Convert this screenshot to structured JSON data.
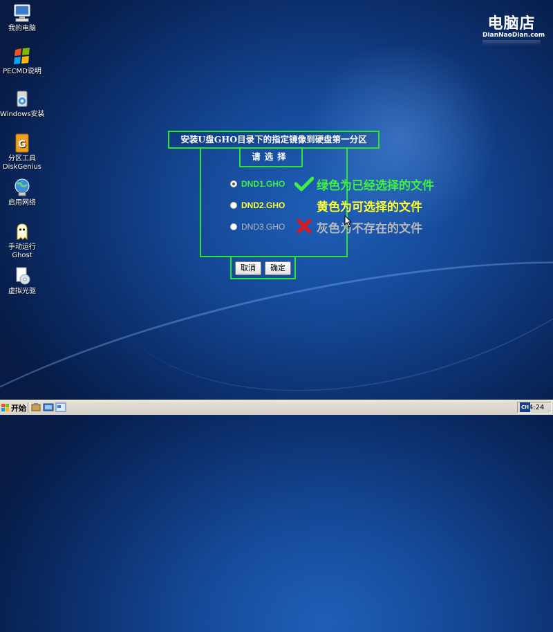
{
  "desktop": {
    "icons": [
      {
        "label": "我的电脑",
        "icon": "my-computer-icon"
      },
      {
        "label": "PECMD说明",
        "icon": "pecmd-help-icon"
      },
      {
        "label": "Windows安装",
        "icon": "windows-install-icon"
      },
      {
        "label1": "分区工具",
        "label2": "DiskGenius",
        "icon": "diskgenius-icon"
      },
      {
        "label": "启用网络",
        "icon": "network-icon"
      },
      {
        "label1": "手动运行",
        "label2": "Ghost",
        "icon": "ghost-icon"
      },
      {
        "label": "虚拟光驱",
        "icon": "virtual-cdrom-icon"
      }
    ]
  },
  "logo": {
    "text": "电脑店",
    "sub": "DianNaoDian.com"
  },
  "dialog": {
    "title": "安装U盘GHO目录下的指定镜像到硬盘第一分区",
    "select_label": "请选择",
    "options": [
      {
        "label": "DND1.GHO",
        "color": "#3ff03f",
        "selected": true
      },
      {
        "label": "DND2.GHO",
        "color": "#ffff33",
        "selected": false
      },
      {
        "label": "DND3.GHO",
        "color": "#b8b8b8",
        "selected": false
      }
    ],
    "cancel_label": "取消",
    "ok_label": "确定"
  },
  "legend": {
    "green": {
      "text": "绿色为已经选择的文件",
      "color": "#3ff03f",
      "icon": "check-icon"
    },
    "yellow": {
      "text": "黄色为可选择的文件",
      "color": "#ffff33"
    },
    "gray": {
      "text": "灰色为不存在的文件",
      "color": "#b8b8b8",
      "icon": "cross-icon"
    }
  },
  "taskbar": {
    "start_label": "开始",
    "lang": "CH",
    "clock": "14:24"
  }
}
